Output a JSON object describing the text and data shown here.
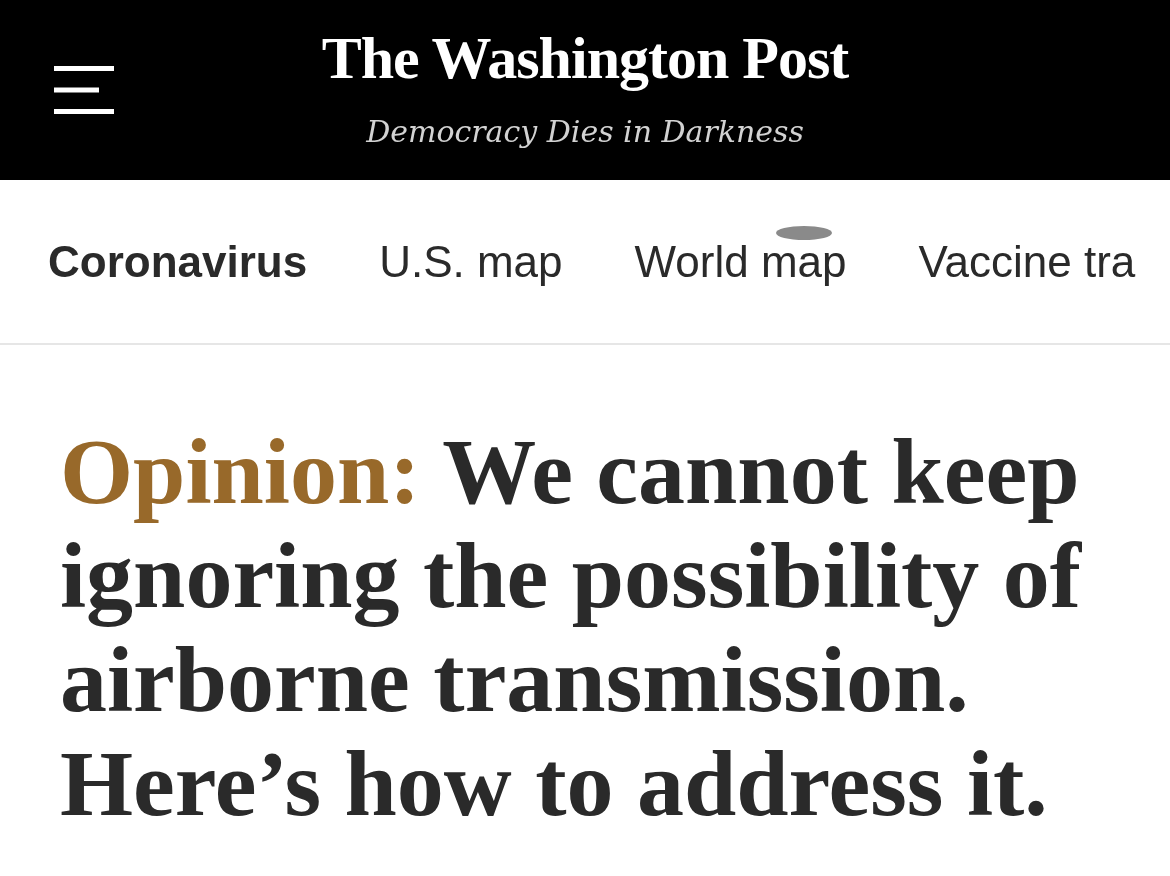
{
  "masthead": {
    "logo": "The Washington Post",
    "tagline": "Democracy Dies in Darkness"
  },
  "nav": {
    "section": "Coronavirus",
    "links": [
      "U.S. map",
      "World map",
      "Vaccine tra"
    ]
  },
  "article": {
    "kicker": "Opinion:",
    "headline": "We cannot keep ignoring the possibility of airborne transmission. Here’s how to address it."
  }
}
